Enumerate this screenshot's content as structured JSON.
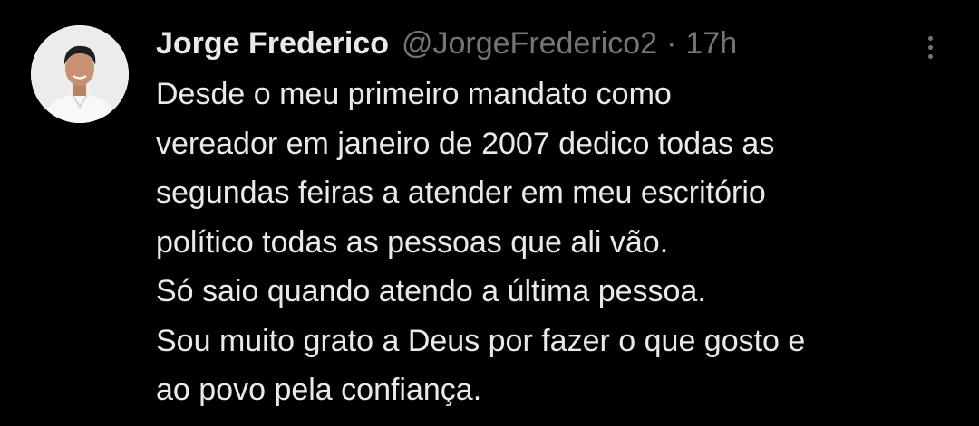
{
  "author": {
    "name": "Jorge Frederico",
    "handle": "@JorgeFrederico2",
    "separator": "·",
    "time": "17h",
    "avatar_icon": "profile-photo"
  },
  "tweet": {
    "lines": [
      "Desde o meu primeiro mandato como",
      "vereador em janeiro de 2007 dedico todas as",
      "segundas feiras a atender em meu escritório",
      "político todas as pessoas que ali vão.",
      "Só saio quando atendo a última pessoa.",
      "Sou muito grato a Deus por fazer o que gosto e",
      "ao povo pela confiança."
    ]
  },
  "actions": {
    "more_icon": "more-vertical-icon"
  },
  "colors": {
    "background": "#000000",
    "primary_text": "#e7e9ea",
    "secondary_text": "#71767b"
  }
}
